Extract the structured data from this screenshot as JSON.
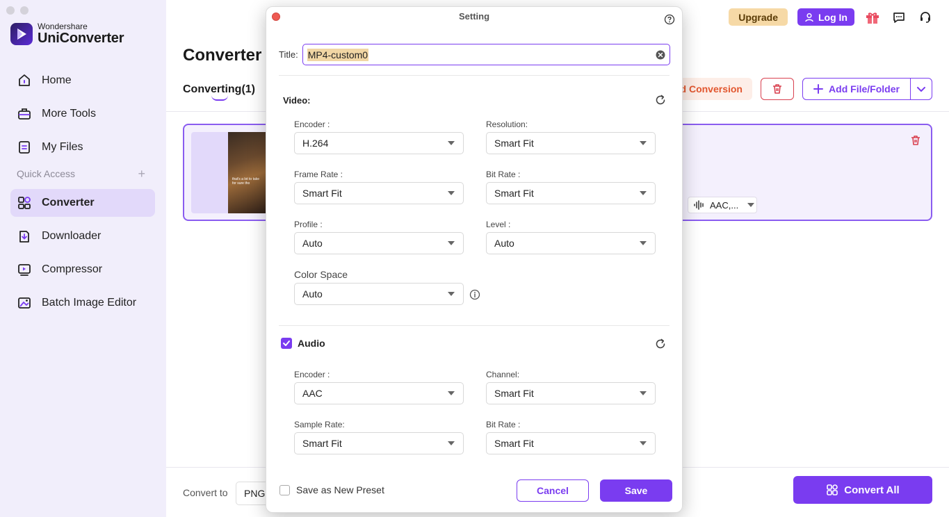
{
  "app": {
    "brand_small": "Wondershare",
    "brand_big": "UniConverter"
  },
  "sidebar": {
    "items_top": [
      {
        "label": "Home",
        "icon": "home-icon"
      },
      {
        "label": "More Tools",
        "icon": "toolbox-icon"
      },
      {
        "label": "My Files",
        "icon": "file-icon"
      }
    ],
    "quick_access_label": "Quick Access",
    "items_bottom": [
      {
        "label": "Converter",
        "icon": "converter-icon",
        "active": true
      },
      {
        "label": "Downloader",
        "icon": "download-icon"
      },
      {
        "label": "Compressor",
        "icon": "compress-icon"
      },
      {
        "label": "Batch Image Editor",
        "icon": "image-edit-icon"
      }
    ]
  },
  "header": {
    "upgrade_label": "Upgrade",
    "login_label": "Log In"
  },
  "main": {
    "title": "Converter",
    "tab_converting": "Converting(1)",
    "conversion_btn": "d Conversion",
    "add_file_label": "Add File/Folder",
    "audio_pill_label": "AAC,..."
  },
  "bottom": {
    "convert_to_label": "Convert to",
    "format_value": "PNG",
    "convert_all_label": "Convert All"
  },
  "thumbnail": {
    "caption": "that's a lot to take for sure tho"
  },
  "modal": {
    "title": "Setting",
    "title_label": "Title:",
    "title_value": "MP4-custom0",
    "video_heading": "Video:",
    "video_fields": {
      "encoder": {
        "label": "Encoder :",
        "value": "H.264"
      },
      "resolution": {
        "label": "Resolution:",
        "value": "Smart Fit"
      },
      "frame_rate": {
        "label": "Frame Rate :",
        "value": "Smart Fit"
      },
      "bit_rate": {
        "label": "Bit Rate :",
        "value": "Smart Fit"
      },
      "profile": {
        "label": "Profile :",
        "value": "Auto"
      },
      "level": {
        "label": "Level :",
        "value": "Auto"
      },
      "color_space": {
        "label": "Color Space",
        "value": "Auto"
      }
    },
    "audio_heading": "Audio",
    "audio_checked": true,
    "audio_fields": {
      "encoder": {
        "label": "Encoder :",
        "value": "AAC"
      },
      "channel": {
        "label": "Channel:",
        "value": "Smart Fit"
      },
      "sample_rate": {
        "label": "Sample Rate:",
        "value": "Smart Fit"
      },
      "bit_rate": {
        "label": "Bit Rate :",
        "value": "Smart Fit"
      }
    },
    "save_preset_label": "Save as New Preset",
    "cancel_label": "Cancel",
    "save_label": "Save"
  },
  "colors": {
    "accent": "#7a3cf0",
    "sidebar_bg": "#f1eefb",
    "upgrade_bg": "#f6d9a6",
    "danger": "#d9404f",
    "close_dot": "#ee5a52"
  }
}
